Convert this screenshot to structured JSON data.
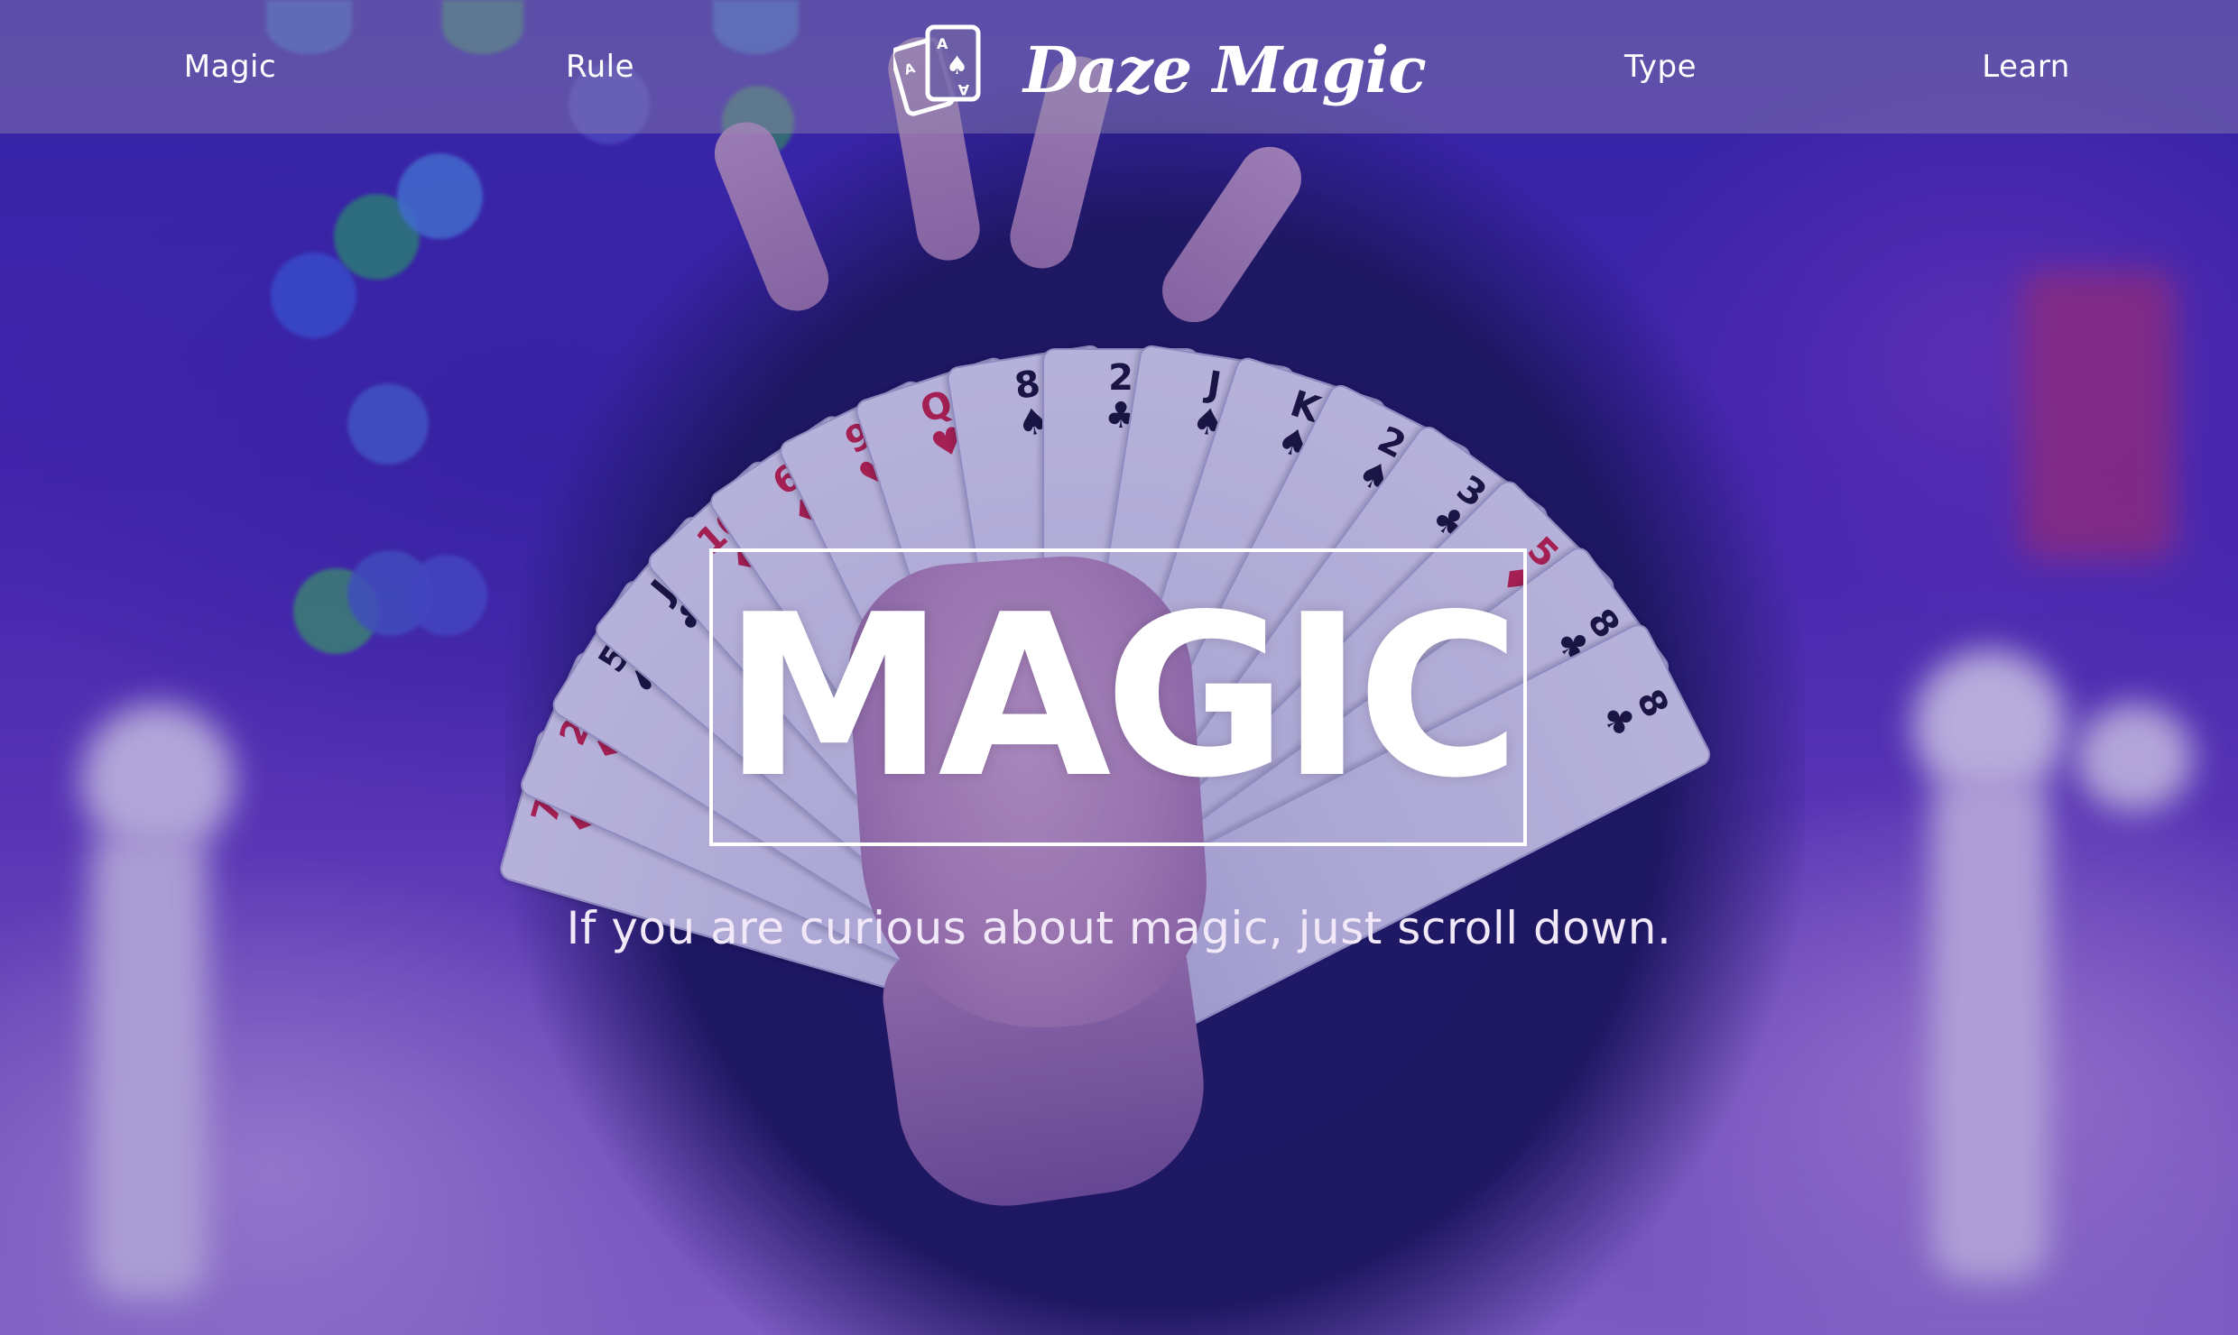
{
  "nav": {
    "links": [
      "Magic",
      "Rule",
      "Type",
      "Learn"
    ],
    "brand": "Daze Magic",
    "logo_icon": "playing-cards-ace-icon"
  },
  "hero": {
    "title": "MAGIC",
    "subtitle": "If you are curious about magic, just scroll down."
  },
  "colors": {
    "overlay": "#2a148c",
    "text": "#ffffff",
    "navbar": "#968caf"
  }
}
